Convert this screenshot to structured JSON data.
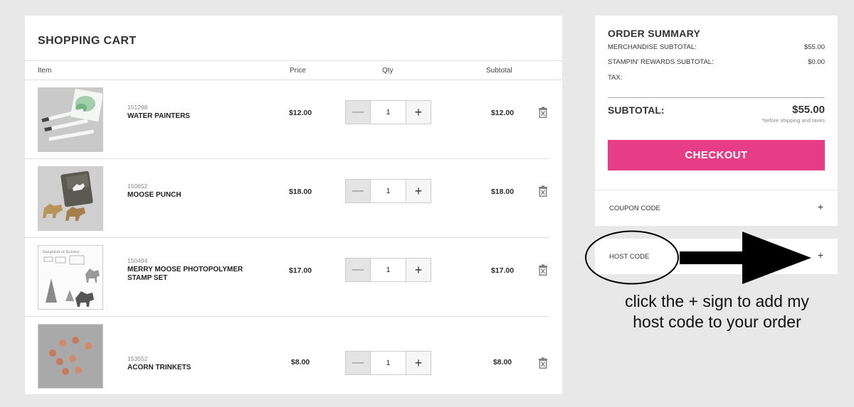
{
  "cart": {
    "title": "SHOPPING CART",
    "headers": {
      "item": "Item",
      "price": "Price",
      "qty": "Qty",
      "subtotal": "Subtotal"
    },
    "items": [
      {
        "sku": "151298",
        "name": "WATER PAINTERS",
        "price": "$12.00",
        "qty": "1",
        "subtotal": "$12.00",
        "thumb": "water-painters-photo"
      },
      {
        "sku": "150652",
        "name": "MOOSE PUNCH",
        "price": "$18.00",
        "qty": "1",
        "subtotal": "$18.00",
        "thumb": "moose-punch-photo"
      },
      {
        "sku": "150494",
        "name": "MERRY MOOSE PHOTOPOLYMER STAMP SET",
        "price": "$17.00",
        "qty": "1",
        "subtotal": "$17.00",
        "thumb": "stamp-set-photo"
      },
      {
        "sku": "153552",
        "name": "ACORN TRINKETS",
        "price": "$8.00",
        "qty": "1",
        "subtotal": "$8.00",
        "thumb": "acorn-trinkets-photo"
      }
    ]
  },
  "summary": {
    "title": "ORDER SUMMARY",
    "merch_label": "MERCHANDISE SUBTOTAL:",
    "merch_value": "$55.00",
    "rewards_label": "STAMPIN' REWARDS SUBTOTAL:",
    "rewards_value": "$0.00",
    "tax_label": "TAX:",
    "subtotal_label": "SUBTOTAL:",
    "subtotal_value": "$55.00",
    "note": "*before shipping and taxes",
    "checkout_label": "CHECKOUT",
    "accent_color": "#e73c86"
  },
  "coupon": {
    "label": "COUPON CODE",
    "toggle": "+"
  },
  "host": {
    "label": "HOST CODE",
    "toggle": "+"
  },
  "annotation": {
    "line1": "click the + sign to add my",
    "line2": "host code to your order"
  },
  "controls": {
    "minus": "—",
    "plus": "+"
  }
}
